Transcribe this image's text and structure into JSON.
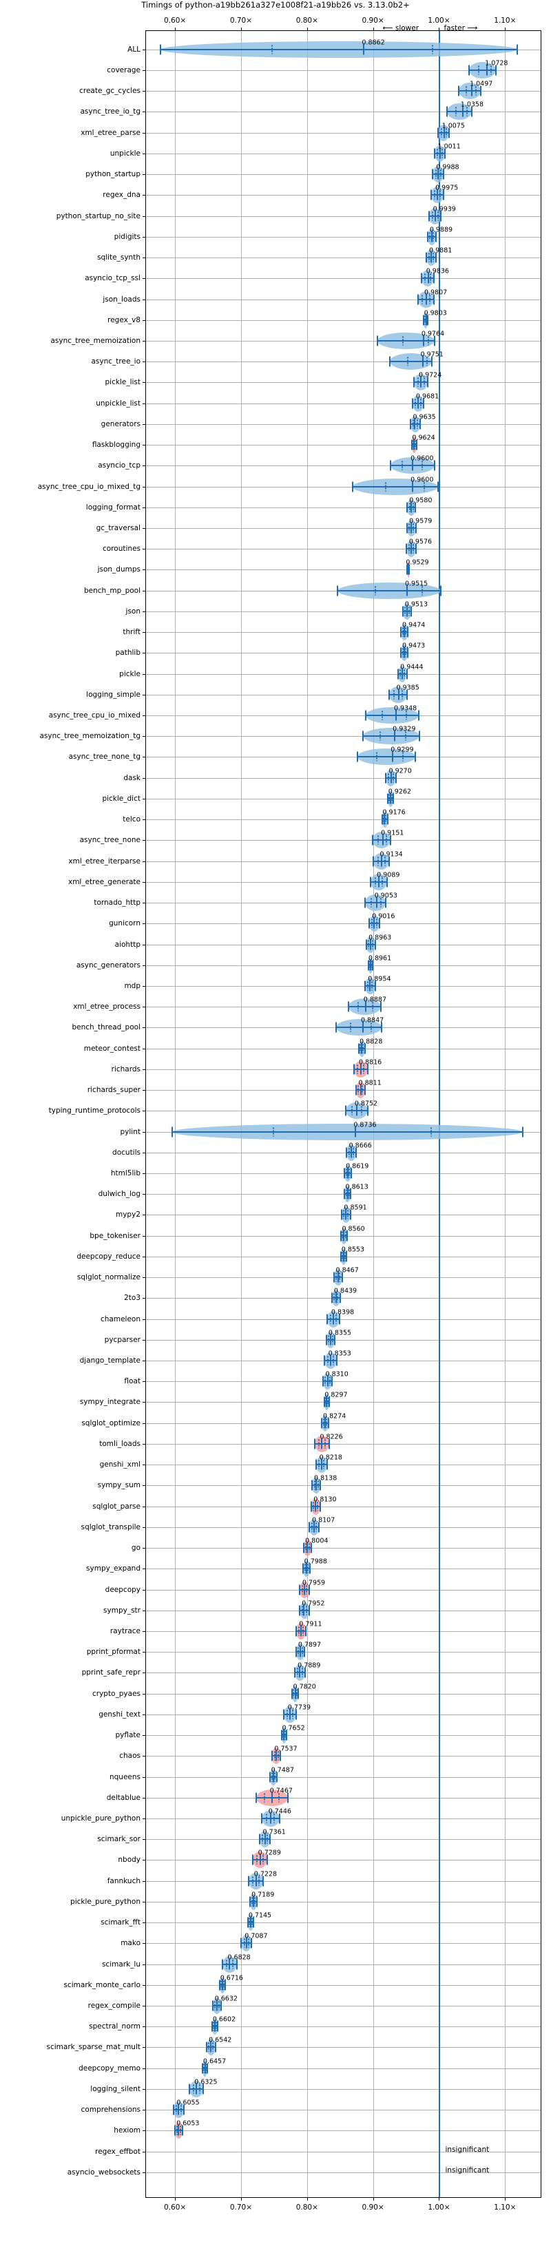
{
  "figure": {
    "title": "Timings of python-a19bb261a327e1008f21-a19bb26 vs. 3.13.0b2+",
    "slower_label": "⟵ slower",
    "faster_label": "faster ⟶",
    "insignificant_label": "insignificant"
  },
  "chart_data": {
    "type": "bar",
    "subtype": "violin-with-error-bars (horizontal, benchmark speedup ratios)",
    "title": "Timings of python-a19bb261a327e1008f21-a19bb26 vs. 3.13.0b2+",
    "xlabel": "",
    "ylabel": "",
    "xlim": [
      0.555,
      1.155
    ],
    "xticks": [
      0.6,
      0.7,
      0.8,
      0.9,
      1.0,
      1.1
    ],
    "xticklabels": [
      "0.60×",
      "0.70×",
      "0.80×",
      "0.90×",
      "1.00×",
      "1.10×"
    ],
    "grid": true,
    "reference_line": 1.0,
    "colors": {
      "faster_violin": "#8cbee1",
      "slower_violin": "#f4a0a0",
      "line": "#1f6cb0",
      "grid": "#b0b0b0",
      "reference": "#1f6cb0"
    },
    "annotations": [
      "⟵ slower",
      "faster ⟶",
      "insignificant"
    ],
    "categories": [
      "ALL",
      "coverage",
      "create_gc_cycles",
      "async_tree_io_tg",
      "xml_etree_parse",
      "unpickle",
      "python_startup",
      "regex_dna",
      "python_startup_no_site",
      "pidigits",
      "sqlite_synth",
      "asyncio_tcp_ssl",
      "json_loads",
      "regex_v8",
      "async_tree_memoization",
      "async_tree_io",
      "pickle_list",
      "unpickle_list",
      "generators",
      "flaskblogging",
      "asyncio_tcp",
      "async_tree_cpu_io_mixed_tg",
      "logging_format",
      "gc_traversal",
      "coroutines",
      "json_dumps",
      "bench_mp_pool",
      "json",
      "thrift",
      "pathlib",
      "pickle",
      "logging_simple",
      "async_tree_cpu_io_mixed",
      "async_tree_memoization_tg",
      "async_tree_none_tg",
      "dask",
      "pickle_dict",
      "telco",
      "async_tree_none",
      "xml_etree_iterparse",
      "xml_etree_generate",
      "tornado_http",
      "gunicorn",
      "aiohttp",
      "async_generators",
      "mdp",
      "xml_etree_process",
      "bench_thread_pool",
      "meteor_contest",
      "richards",
      "richards_super",
      "typing_runtime_protocols",
      "pylint",
      "docutils",
      "html5lib",
      "dulwich_log",
      "mypy2",
      "bpe_tokeniser",
      "deepcopy_reduce",
      "sqlglot_normalize",
      "2to3",
      "chameleon",
      "pycparser",
      "django_template",
      "float",
      "sympy_integrate",
      "sqlglot_optimize",
      "tomli_loads",
      "genshi_xml",
      "sympy_sum",
      "sqlglot_parse",
      "sqlglot_transpile",
      "go",
      "sympy_expand",
      "deepcopy",
      "sympy_str",
      "raytrace",
      "pprint_pformat",
      "pprint_safe_repr",
      "crypto_pyaes",
      "genshi_text",
      "pyflate",
      "chaos",
      "nqueens",
      "deltablue",
      "unpickle_pure_python",
      "scimark_sor",
      "nbody",
      "fannkuch",
      "pickle_pure_python",
      "scimark_fft",
      "mako",
      "scimark_lu",
      "scimark_monte_carlo",
      "regex_compile",
      "spectral_norm",
      "scimark_sparse_mat_mult",
      "deepcopy_memo",
      "logging_silent",
      "comprehensions",
      "hexiom",
      "regex_effbot",
      "asyncio_websockets"
    ],
    "values": [
      0.8862,
      1.0728,
      1.0497,
      1.0358,
      1.0075,
      1.0011,
      0.9988,
      0.9975,
      0.9939,
      0.9889,
      0.9881,
      0.9836,
      0.9807,
      0.9803,
      0.9764,
      0.9751,
      0.9724,
      0.9681,
      0.9635,
      0.9624,
      0.96,
      0.96,
      0.958,
      0.9579,
      0.9576,
      0.9529,
      0.9515,
      0.9513,
      0.9474,
      0.9473,
      0.9444,
      0.9385,
      0.9348,
      0.9329,
      0.9299,
      0.927,
      0.9262,
      0.9176,
      0.9151,
      0.9134,
      0.9089,
      0.9053,
      0.9016,
      0.8963,
      0.8961,
      0.8954,
      0.8887,
      0.8847,
      0.8828,
      0.8816,
      0.8811,
      0.8752,
      0.8736,
      0.8666,
      0.8619,
      0.8613,
      0.8591,
      0.856,
      0.8553,
      0.8467,
      0.8439,
      0.8398,
      0.8355,
      0.8353,
      0.831,
      0.8297,
      0.8274,
      0.8226,
      0.8218,
      0.8138,
      0.813,
      0.8107,
      0.8004,
      0.7988,
      0.7959,
      0.7952,
      0.7911,
      0.7897,
      0.7889,
      0.782,
      0.7739,
      0.7652,
      0.7537,
      0.7487,
      0.7467,
      0.7446,
      0.7361,
      0.7289,
      0.7228,
      0.7189,
      0.7145,
      0.7087,
      0.6828,
      0.6716,
      0.6632,
      0.6602,
      0.6542,
      0.6457,
      0.6325,
      0.6055,
      0.6053,
      null,
      null
    ],
    "value_labels": [
      "0.8862",
      "1.0728",
      "1.0497",
      "1.0358",
      "1.0075",
      "1.0011",
      "0.9988",
      "0.9975",
      "0.9939",
      "0.9889",
      "0.9881",
      "0.9836",
      "0.9807",
      "0.9803",
      "0.9764",
      "0.9751",
      "0.9724",
      "0.9681",
      "0.9635",
      "0.9624",
      "0.9600",
      "0.9600",
      "0.9580",
      "0.9579",
      "0.9576",
      "0.9529",
      "0.9515",
      "0.9513",
      "0.9474",
      "0.9473",
      "0.9444",
      "0.9385",
      "0.9348",
      "0.9329",
      "0.9299",
      "0.9270",
      "0.9262",
      "0.9176",
      "0.9151",
      "0.9134",
      "0.9089",
      "0.9053",
      "0.9016",
      "0.8963",
      "0.8961",
      "0.8954",
      "0.8887",
      "0.8847",
      "0.8828",
      "0.8816",
      "0.8811",
      "0.8752",
      "0.8736",
      "0.8666",
      "0.8619",
      "0.8613",
      "0.8591",
      "0.8560",
      "0.8553",
      "0.8467",
      "0.8439",
      "0.8398",
      "0.8355",
      "0.8353",
      "0.8310",
      "0.8297",
      "0.8274",
      "0.8226",
      "0.8218",
      "0.8138",
      "0.8130",
      "0.8107",
      "0.8004",
      "0.7988",
      "0.7959",
      "0.7952",
      "0.7911",
      "0.7897",
      "0.7889",
      "0.7820",
      "0.7739",
      "0.7652",
      "0.7537",
      "0.7487",
      "0.7467",
      "0.7446",
      "0.7361",
      "0.7289",
      "0.7228",
      "0.7189",
      "0.7145",
      "0.7087",
      "0.6828",
      "0.6716",
      "0.6632",
      "0.6602",
      "0.6542",
      "0.6457",
      "0.6325",
      "0.6055",
      "0.6053",
      "insignificant",
      "insignificant"
    ],
    "violin_color_flags": [
      "blue",
      "blue",
      "blue",
      "blue",
      "blue",
      "blue",
      "blue",
      "blue",
      "blue",
      "blue",
      "blue",
      "blue",
      "blue",
      "blue",
      "blue",
      "blue",
      "blue",
      "blue",
      "blue",
      "red",
      "blue",
      "blue",
      "blue",
      "blue",
      "blue",
      "red",
      "blue",
      "blue",
      "blue",
      "blue",
      "blue",
      "blue",
      "blue",
      "blue",
      "blue",
      "blue",
      "blue",
      "blue",
      "blue",
      "blue",
      "blue",
      "blue",
      "blue",
      "blue",
      "blue",
      "blue",
      "blue",
      "blue",
      "blue",
      "red",
      "red",
      "blue",
      "blue",
      "blue",
      "blue",
      "blue",
      "blue",
      "blue",
      "blue",
      "blue",
      "blue",
      "blue",
      "blue",
      "blue",
      "blue",
      "blue",
      "blue",
      "red",
      "blue",
      "blue",
      "red",
      "blue",
      "red",
      "blue",
      "red",
      "blue",
      "red",
      "blue",
      "blue",
      "blue",
      "blue",
      "blue",
      "red",
      "blue",
      "red",
      "blue",
      "blue",
      "red",
      "blue",
      "blue",
      "blue",
      "blue",
      "blue",
      "blue",
      "blue",
      "blue",
      "blue",
      "blue",
      "blue",
      "blue",
      "red",
      "none",
      "none"
    ],
    "spread_lo": [
      0.578,
      1.045,
      1.03,
      1.012,
      0.998,
      0.993,
      0.99,
      0.988,
      0.985,
      0.983,
      0.981,
      0.973,
      0.968,
      0.977,
      0.907,
      0.925,
      0.962,
      0.96,
      0.957,
      0.959,
      0.926,
      0.869,
      0.952,
      0.951,
      0.95,
      0.951,
      0.846,
      0.945,
      0.942,
      0.942,
      0.938,
      0.924,
      0.889,
      0.885,
      0.876,
      0.919,
      0.922,
      0.914,
      0.899,
      0.9,
      0.896,
      0.888,
      0.894,
      0.89,
      0.893,
      0.888,
      0.863,
      0.844,
      0.878,
      0.871,
      0.874,
      0.859,
      0.596,
      0.86,
      0.857,
      0.857,
      0.852,
      0.851,
      0.851,
      0.841,
      0.838,
      0.83,
      0.829,
      0.826,
      0.824,
      0.826,
      0.822,
      0.812,
      0.814,
      0.808,
      0.806,
      0.803,
      0.795,
      0.794,
      0.789,
      0.789,
      0.784,
      0.783,
      0.781,
      0.777,
      0.765,
      0.762,
      0.747,
      0.744,
      0.723,
      0.731,
      0.728,
      0.718,
      0.712,
      0.714,
      0.71,
      0.7,
      0.672,
      0.668,
      0.657,
      0.656,
      0.648,
      0.642,
      0.622,
      0.598,
      0.6,
      null,
      null
    ],
    "spread_hi": [
      1.118,
      1.086,
      1.063,
      1.05,
      1.015,
      1.009,
      1.007,
      1.007,
      1.003,
      0.995,
      0.995,
      0.992,
      0.992,
      0.983,
      0.993,
      0.989,
      0.983,
      0.977,
      0.971,
      0.966,
      0.993,
      0.998,
      0.964,
      0.965,
      0.965,
      0.955,
      1.003,
      0.958,
      0.953,
      0.953,
      0.951,
      0.951,
      0.969,
      0.97,
      0.964,
      0.935,
      0.931,
      0.922,
      0.926,
      0.924,
      0.921,
      0.919,
      0.91,
      0.903,
      0.899,
      0.903,
      0.912,
      0.913,
      0.888,
      0.892,
      0.888,
      0.892,
      1.127,
      0.874,
      0.867,
      0.866,
      0.866,
      0.861,
      0.86,
      0.853,
      0.85,
      0.849,
      0.842,
      0.845,
      0.838,
      0.834,
      0.833,
      0.834,
      0.83,
      0.82,
      0.82,
      0.818,
      0.806,
      0.804,
      0.803,
      0.803,
      0.798,
      0.796,
      0.797,
      0.787,
      0.783,
      0.769,
      0.76,
      0.754,
      0.771,
      0.758,
      0.744,
      0.74,
      0.733,
      0.724,
      0.719,
      0.716,
      0.694,
      0.676,
      0.67,
      0.665,
      0.661,
      0.649,
      0.643,
      0.613,
      0.611,
      null,
      null
    ]
  }
}
